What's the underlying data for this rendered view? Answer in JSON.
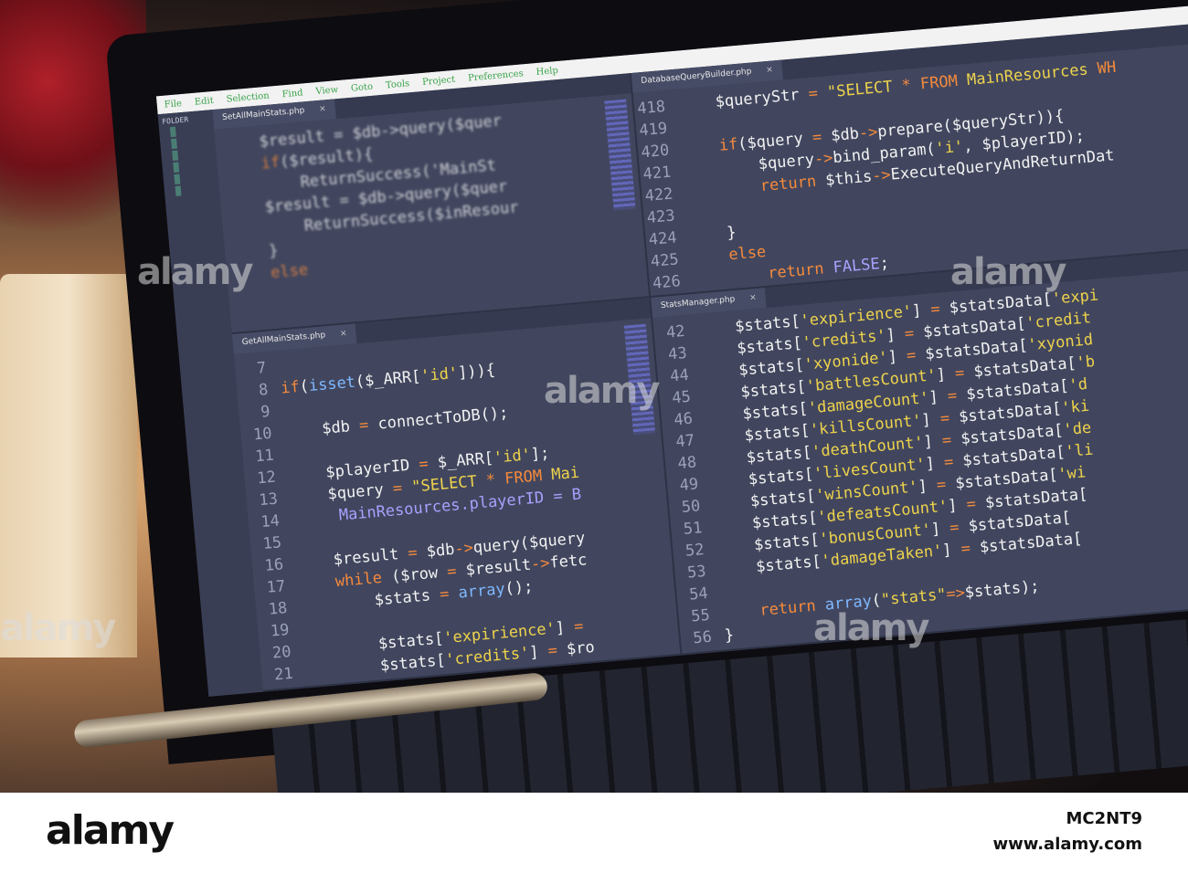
{
  "menu": [
    "File",
    "Edit",
    "Selection",
    "Find",
    "View",
    "Goto",
    "Tools",
    "Project",
    "Preferences",
    "Help"
  ],
  "sidebar": {
    "title": "FOLDER"
  },
  "panes": {
    "top_left": {
      "tab": "SetAllMainStats.php",
      "lines": [
        {
          "n": "",
          "t": [
            [
              "v",
              "$result = $db->query($quer"
            ]
          ]
        },
        {
          "n": "",
          "t": [
            [
              "k",
              "if"
            ],
            [
              "v",
              "($result){"
            ]
          ]
        },
        {
          "n": "",
          "t": [
            [
              "v",
              "    ReturnSuccess('MainSt"
            ]
          ]
        },
        {
          "n": "",
          "t": [
            [
              "v",
              "$result = $db->query($quer"
            ]
          ]
        },
        {
          "n": "",
          "t": [
            [
              "v",
              "    ReturnSuccess($inResour"
            ]
          ]
        },
        {
          "n": "",
          "t": [
            [
              "v",
              "}"
            ]
          ]
        },
        {
          "n": "",
          "t": [
            [
              "k",
              "else"
            ]
          ]
        }
      ]
    },
    "bottom_left": {
      "tab": "GetAllMainStats.php",
      "lines": [
        {
          "n": "7",
          "t": []
        },
        {
          "n": "8",
          "t": [
            [
              "k",
              "if"
            ],
            [
              "v",
              "("
            ],
            [
              "f",
              "isset"
            ],
            [
              "v",
              "($_ARR["
            ],
            [
              "s",
              "'id'"
            ],
            [
              "v",
              "])){"
            ]
          ]
        },
        {
          "n": "9",
          "t": []
        },
        {
          "n": "10",
          "t": [
            [
              "v",
              "    $db "
            ],
            [
              "k",
              "="
            ],
            [
              "v",
              " connectToDB();"
            ]
          ]
        },
        {
          "n": "11",
          "t": []
        },
        {
          "n": "12",
          "t": [
            [
              "v",
              "    $playerID "
            ],
            [
              "k",
              "="
            ],
            [
              "v",
              " $_ARR["
            ],
            [
              "s",
              "'id'"
            ],
            [
              "v",
              "];"
            ]
          ]
        },
        {
          "n": "13",
          "t": [
            [
              "v",
              "    $query "
            ],
            [
              "k",
              "="
            ],
            [
              "s",
              " \"SELECT "
            ],
            [
              "k",
              "* FROM"
            ],
            [
              "s",
              " Mai"
            ]
          ]
        },
        {
          "n": "14",
          "t": [
            [
              "c",
              "     MainResources.playerID = B"
            ]
          ]
        },
        {
          "n": "15",
          "t": []
        },
        {
          "n": "16",
          "t": [
            [
              "v",
              "    $result "
            ],
            [
              "k",
              "="
            ],
            [
              "v",
              " $db"
            ],
            [
              "k",
              "->"
            ],
            [
              "v",
              "query($query"
            ]
          ]
        },
        {
          "n": "17",
          "t": [
            [
              "k",
              "    while"
            ],
            [
              "v",
              " ($row "
            ],
            [
              "k",
              "="
            ],
            [
              "v",
              " $result"
            ],
            [
              "k",
              "->"
            ],
            [
              "v",
              "fetc"
            ]
          ]
        },
        {
          "n": "18",
          "t": [
            [
              "v",
              "        $stats "
            ],
            [
              "k",
              "="
            ],
            [
              "f",
              " array"
            ],
            [
              "v",
              "();"
            ]
          ]
        },
        {
          "n": "19",
          "t": []
        },
        {
          "n": "20",
          "t": [
            [
              "v",
              "        $stats["
            ],
            [
              "s",
              "'expirience'"
            ],
            [
              "v",
              "] "
            ],
            [
              "k",
              "="
            ]
          ]
        },
        {
          "n": "21",
          "t": [
            [
              "v",
              "        $stats["
            ],
            [
              "s",
              "'credits'"
            ],
            [
              "v",
              "] "
            ],
            [
              "k",
              "="
            ],
            [
              "v",
              " $ro"
            ]
          ]
        }
      ]
    },
    "top_right": {
      "tab": "DatabaseQueryBuilder.php",
      "lines": [
        {
          "n": "418",
          "t": [
            [
              "v",
              "    $queryStr "
            ],
            [
              "k",
              "="
            ],
            [
              "s",
              " \"SELECT "
            ],
            [
              "k",
              "* FROM "
            ],
            [
              "s",
              "MainResources "
            ],
            [
              "k",
              "WH"
            ]
          ]
        },
        {
          "n": "419",
          "t": []
        },
        {
          "n": "420",
          "t": [
            [
              "k",
              "    if"
            ],
            [
              "v",
              "($query "
            ],
            [
              "k",
              "="
            ],
            [
              "v",
              " $db"
            ],
            [
              "k",
              "->"
            ],
            [
              "v",
              "prepare($queryStr)){"
            ]
          ]
        },
        {
          "n": "421",
          "t": [
            [
              "v",
              "        $query"
            ],
            [
              "k",
              "->"
            ],
            [
              "v",
              "bind_param("
            ],
            [
              "s",
              "'i'"
            ],
            [
              "v",
              ", $playerID);"
            ]
          ]
        },
        {
          "n": "422",
          "t": [
            [
              "k",
              "        return"
            ],
            [
              "v",
              " $this"
            ],
            [
              "k",
              "->"
            ],
            [
              "v",
              "ExecuteQueryAndReturnDat"
            ]
          ]
        },
        {
          "n": "423",
          "t": []
        },
        {
          "n": "424",
          "t": [
            [
              "v",
              "    }"
            ]
          ]
        },
        {
          "n": "425",
          "t": [
            [
              "k",
              "    else"
            ]
          ]
        },
        {
          "n": "426",
          "t": [
            [
              "k",
              "        return"
            ],
            [
              "c",
              " FALSE"
            ],
            [
              "v",
              ";"
            ]
          ]
        }
      ]
    },
    "bottom_right": {
      "tab": "StatsManager.php",
      "lines": [
        {
          "n": "42",
          "t": [
            [
              "v",
              "    $stats["
            ],
            [
              "s",
              "'expirience'"
            ],
            [
              "v",
              "] "
            ],
            [
              "k",
              "="
            ],
            [
              "v",
              " $statsData["
            ],
            [
              "s",
              "'expi"
            ]
          ]
        },
        {
          "n": "43",
          "t": [
            [
              "v",
              "    $stats["
            ],
            [
              "s",
              "'credits'"
            ],
            [
              "v",
              "] "
            ],
            [
              "k",
              "="
            ],
            [
              "v",
              " $statsData["
            ],
            [
              "s",
              "'credit"
            ]
          ]
        },
        {
          "n": "44",
          "t": [
            [
              "v",
              "    $stats["
            ],
            [
              "s",
              "'xyonide'"
            ],
            [
              "v",
              "] "
            ],
            [
              "k",
              "="
            ],
            [
              "v",
              " $statsData["
            ],
            [
              "s",
              "'xyonid"
            ]
          ]
        },
        {
          "n": "45",
          "t": [
            [
              "v",
              "    $stats["
            ],
            [
              "s",
              "'battlesCount'"
            ],
            [
              "v",
              "] "
            ],
            [
              "k",
              "="
            ],
            [
              "v",
              " $statsData["
            ],
            [
              "s",
              "'b"
            ]
          ]
        },
        {
          "n": "46",
          "t": [
            [
              "v",
              "    $stats["
            ],
            [
              "s",
              "'damageCount'"
            ],
            [
              "v",
              "] "
            ],
            [
              "k",
              "="
            ],
            [
              "v",
              " $statsData["
            ],
            [
              "s",
              "'d"
            ]
          ]
        },
        {
          "n": "47",
          "t": [
            [
              "v",
              "    $stats["
            ],
            [
              "s",
              "'killsCount'"
            ],
            [
              "v",
              "] "
            ],
            [
              "k",
              "="
            ],
            [
              "v",
              " $statsData["
            ],
            [
              "s",
              "'ki"
            ]
          ]
        },
        {
          "n": "48",
          "t": [
            [
              "v",
              "    $stats["
            ],
            [
              "s",
              "'deathCount'"
            ],
            [
              "v",
              "] "
            ],
            [
              "k",
              "="
            ],
            [
              "v",
              " $statsData["
            ],
            [
              "s",
              "'de"
            ]
          ]
        },
        {
          "n": "49",
          "t": [
            [
              "v",
              "    $stats["
            ],
            [
              "s",
              "'livesCount'"
            ],
            [
              "v",
              "] "
            ],
            [
              "k",
              "="
            ],
            [
              "v",
              " $statsData["
            ],
            [
              "s",
              "'li"
            ]
          ]
        },
        {
          "n": "50",
          "t": [
            [
              "v",
              "    $stats["
            ],
            [
              "s",
              "'winsCount'"
            ],
            [
              "v",
              "] "
            ],
            [
              "k",
              "="
            ],
            [
              "v",
              " $statsData["
            ],
            [
              "s",
              "'wi"
            ]
          ]
        },
        {
          "n": "51",
          "t": [
            [
              "v",
              "    $stats["
            ],
            [
              "s",
              "'defeatsCount'"
            ],
            [
              "v",
              "] "
            ],
            [
              "k",
              "="
            ],
            [
              "v",
              " $statsData["
            ]
          ]
        },
        {
          "n": "52",
          "t": [
            [
              "v",
              "    $stats["
            ],
            [
              "s",
              "'bonusCount'"
            ],
            [
              "v",
              "] "
            ],
            [
              "k",
              "="
            ],
            [
              "v",
              " $statsData["
            ]
          ]
        },
        {
          "n": "53",
          "t": [
            [
              "v",
              "    $stats["
            ],
            [
              "s",
              "'damageTaken'"
            ],
            [
              "v",
              "] "
            ],
            [
              "k",
              "="
            ],
            [
              "v",
              " $statsData["
            ]
          ]
        },
        {
          "n": "54",
          "t": []
        },
        {
          "n": "55",
          "t": [
            [
              "k",
              "    return"
            ],
            [
              "f",
              " array"
            ],
            [
              "v",
              "("
            ],
            [
              "s",
              "\"stats\""
            ],
            [
              "k",
              "=>"
            ],
            [
              "v",
              "$stats);"
            ]
          ]
        },
        {
          "n": "56",
          "t": [
            [
              "v",
              "}"
            ]
          ]
        }
      ]
    }
  },
  "watermark": "alamy",
  "footer": {
    "logo": "alamy",
    "image_id": "MC2NT9",
    "site": "www.alamy.com"
  }
}
